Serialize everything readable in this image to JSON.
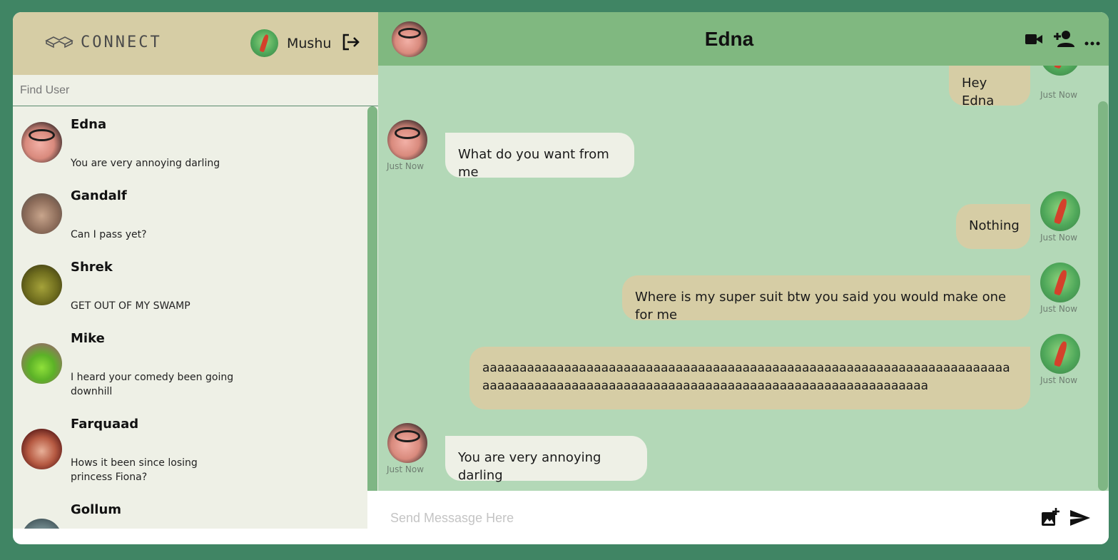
{
  "app": {
    "logo_text": "CONNECT"
  },
  "current_user": {
    "name": "Mushu",
    "avatar": "mushu-avatar"
  },
  "search": {
    "placeholder": "Find User"
  },
  "users": [
    {
      "name": "Edna",
      "last_message": "You are very annoying darling"
    },
    {
      "name": "Gandalf",
      "last_message": "Can I pass yet?"
    },
    {
      "name": "Shrek",
      "last_message": "GET OUT OF MY SWAMP"
    },
    {
      "name": "Mike",
      "last_message": "I heard your comedy been going downhill"
    },
    {
      "name": "Farquaad",
      "last_message": "Hows it been since losing princess Fiona?"
    },
    {
      "name": "Gollum",
      "last_message": ""
    }
  ],
  "chat": {
    "title": "Edna",
    "messages": [
      {
        "from": "me",
        "text": "Hey Edna",
        "time": "Just Now"
      },
      {
        "from": "them",
        "text": "What do you want from me",
        "time": "Just Now"
      },
      {
        "from": "me",
        "text": "Nothing",
        "time": "Just Now"
      },
      {
        "from": "me",
        "text": "Where is my super suit btw you said you would make one for me",
        "time": "Just Now"
      },
      {
        "from": "me",
        "text": "aaaaaaaaaaaaaaaaaaaaaaaaaaaaaaaaaaaaaaaaaaaaaaaaaaaaaaaaaaaaaaaaaaaaaaaaaaaaaaaaaaaaaaaaaaaaaaaaaaaaaaaaaaaaaaaaaaaaaaaaaaaaaaaaaaa",
        "time": "Just Now"
      },
      {
        "from": "them",
        "text": "You are very annoying darling",
        "time": "Just Now"
      }
    ]
  },
  "composer": {
    "placeholder": "Send Messasge Here"
  },
  "icons": {
    "logout": "logout-icon",
    "video": "video-call-icon",
    "add_user": "add-user-icon",
    "more": "more-icon",
    "add_image": "add-image-icon",
    "send": "send-icon"
  },
  "colors": {
    "background": "#408564",
    "header_sand": "#d6cda5",
    "chat_header": "#80b880",
    "chat_bg": "#b3d8b7",
    "sidebar_bg": "#eef0e6",
    "incoming_bubble": "#eef0e6",
    "outgoing_bubble": "#d6cda5"
  }
}
